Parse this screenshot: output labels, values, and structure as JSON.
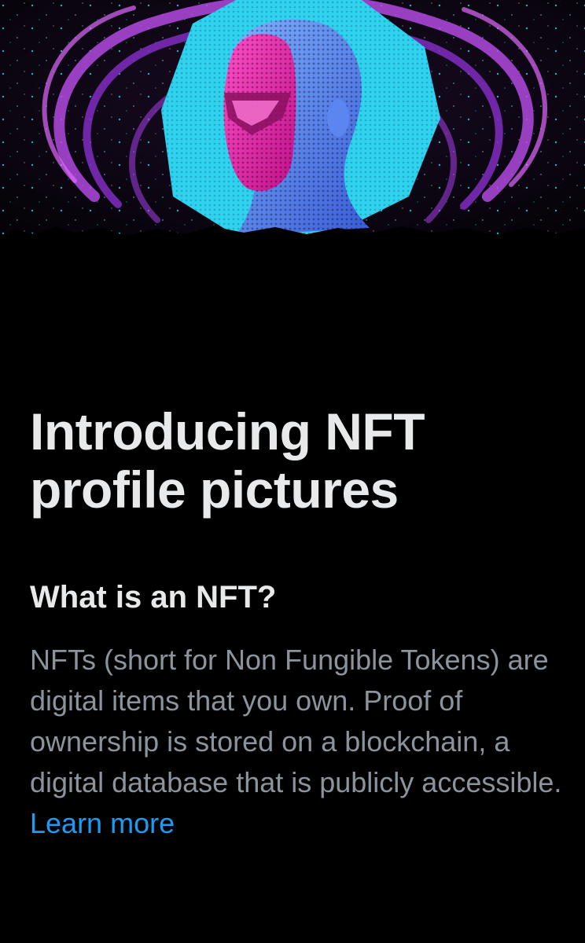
{
  "hero": {
    "image_name": "nft-artwork-illustration"
  },
  "article": {
    "title": "Introducing NFT profile pictures",
    "subheading": "What is an NFT?",
    "paragraph_text": "NFTs (short for Non Fungible Tokens) are digital items that you own. Proof of ownership is stored on a blockchain, a digital database that is publicly accessible.",
    "learn_more_label": "Learn more"
  },
  "colors": {
    "background": "#000000",
    "title": "#e7e9ea",
    "body": "#8b949c",
    "link": "#1d9bf0",
    "accent_cyan": "#2fd3f0",
    "accent_magenta": "#e01aa0",
    "accent_purple": "#9a3ad8"
  }
}
